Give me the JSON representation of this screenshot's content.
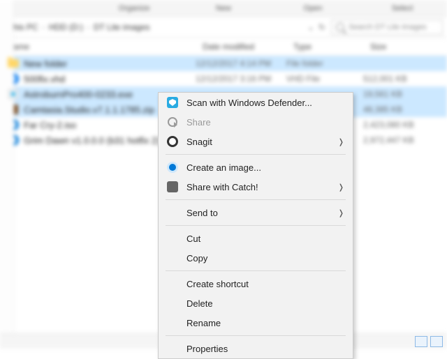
{
  "ribbon": {
    "tabs": [
      "",
      "Organize",
      "New",
      "Open",
      "Select"
    ]
  },
  "breadcrumb": {
    "segments": [
      "This PC",
      "HDD (D:)",
      "DT Lite images"
    ]
  },
  "search": {
    "placeholder": "Search DT Lite images"
  },
  "columns": {
    "name": "Name",
    "date": "Date modified",
    "type": "Type",
    "size": "Size"
  },
  "files": [
    {
      "name": "New folder",
      "date": "12/12/2017 4:14 PM",
      "type": "File folder",
      "size": "",
      "icon": "folder",
      "selected": true
    },
    {
      "name": "500fix.vhd",
      "date": "12/12/2017 3:16 PM",
      "type": "VHD File",
      "size": "512,001 KB",
      "icon": "vhd",
      "selected": false
    },
    {
      "name": "AstroburnPro400-0233.exe",
      "date": "",
      "type": "",
      "size": "19,561 KB",
      "icon": "exe",
      "selected": true
    },
    {
      "name": "Camtasia.Studio.v7.1.1.1785.zip",
      "date": "",
      "type": "",
      "size": "48,385 KB",
      "icon": "zip",
      "selected": true
    },
    {
      "name": "Far Cry-2.iso",
      "date": "",
      "type": "",
      "size": "2,423,080 KB",
      "icon": "iso",
      "selected": false
    },
    {
      "name": "Grim Dawn v1.0.0.0 (b31 hotfix 2)",
      "date": "",
      "type": "",
      "size": "2,972,447 KB",
      "icon": "iso",
      "selected": false
    }
  ],
  "context_menu": {
    "items": [
      {
        "kind": "item",
        "label": "Scan with Windows Defender...",
        "icon": "defender",
        "enabled": true,
        "submenu": false
      },
      {
        "kind": "item",
        "label": "Share",
        "icon": "share-d",
        "enabled": false,
        "submenu": false
      },
      {
        "kind": "item",
        "label": "Snagit",
        "icon": "snagit",
        "enabled": true,
        "submenu": true
      },
      {
        "kind": "sep"
      },
      {
        "kind": "item",
        "label": "Create an image...",
        "icon": "create",
        "enabled": true,
        "submenu": false
      },
      {
        "kind": "item",
        "label": "Share with Catch!",
        "icon": "catch",
        "enabled": true,
        "submenu": true
      },
      {
        "kind": "sep"
      },
      {
        "kind": "item",
        "label": "Send to",
        "icon": "",
        "enabled": true,
        "submenu": true
      },
      {
        "kind": "sep"
      },
      {
        "kind": "item",
        "label": "Cut",
        "icon": "",
        "enabled": true,
        "submenu": false
      },
      {
        "kind": "item",
        "label": "Copy",
        "icon": "",
        "enabled": true,
        "submenu": false
      },
      {
        "kind": "sep"
      },
      {
        "kind": "item",
        "label": "Create shortcut",
        "icon": "",
        "enabled": true,
        "submenu": false
      },
      {
        "kind": "item",
        "label": "Delete",
        "icon": "",
        "enabled": true,
        "submenu": false
      },
      {
        "kind": "item",
        "label": "Rename",
        "icon": "",
        "enabled": true,
        "submenu": false
      },
      {
        "kind": "sep"
      },
      {
        "kind": "item",
        "label": "Properties",
        "icon": "",
        "enabled": true,
        "submenu": false
      }
    ]
  }
}
